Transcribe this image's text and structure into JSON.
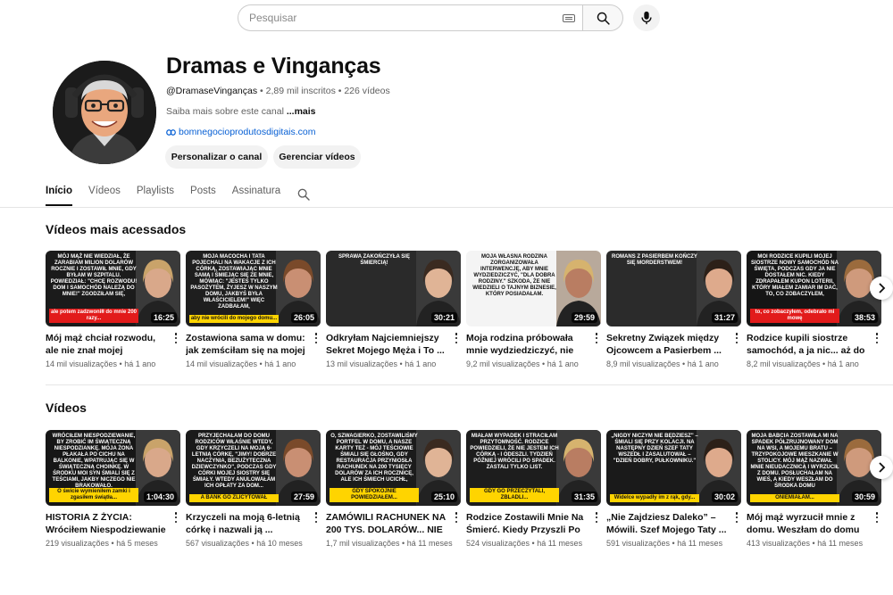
{
  "search": {
    "placeholder": "Pesquisar"
  },
  "channel": {
    "name": "Dramas e Vinganças",
    "handle": "@DramaseVinganças",
    "subscribers": "2,89 mil inscritos",
    "videos_count": "226 vídeos",
    "about": "Saiba mais sobre este canal",
    "about_more": "...mais",
    "link": "bomnegocioprodutosdigitais.com",
    "customize_label": "Personalizar o canal",
    "manage_label": "Gerenciar vídeos"
  },
  "tabs": [
    "Início",
    "Vídeos",
    "Playlists",
    "Posts",
    "Assinatura"
  ],
  "sections": {
    "popular": {
      "title": "Vídeos mais acessados",
      "videos": [
        {
          "title": "Mój mąż chciał rozwodu, ale nie znał mojej tajemnicy...",
          "views": "14 mil visualizações",
          "age": "há 1 ano",
          "duration": "16:25",
          "thumb_text": "Mój mąż nie wiedział, że zarabiam milion dolarów rocznie i zostawił mnie, gdy byłam w szpitalu. Powiedział: \"Chcę rozwodu! Dom i samochód należą do mnie!\" Zgodziłam się,",
          "thumb_bar": "ale potem zadzwoniłł do mnie 200 razy...",
          "bg": "#1b1b1b",
          "bar": "#e21b1b"
        },
        {
          "title": "Zostawiona sama w domu: jak zemściłam się na mojej ...",
          "views": "14 mil visualizações",
          "age": "há 1 ano",
          "duration": "26:05",
          "thumb_text": "Moja macocha i tata pojechali na wakacje z ich córką, zostawiając mnie samą i śmiejąc się ze mnie, mówiąc: \"Jesteś tylko pasożytem, żyjesz w naszym domu, jakbyś była właścicielem!\" Więc zadbałam,",
          "thumb_bar": "aby nie wrócili do mojego domu...",
          "bg": "#1e1e1e",
          "bar": "#ffd400"
        },
        {
          "title": "Odkryłam Najciemniejszy Sekret Mojego Męża i To ...",
          "views": "13 mil visualizações",
          "age": "há 1 ano",
          "duration": "30:21",
          "thumb_text": "Sprawa zakończyła się śmiercią!",
          "thumb_bar": "",
          "bg": "#2a2a2a",
          "bar": "#ffd400"
        },
        {
          "title": "Moja rodzina próbowała mnie wydziedziczyć, nie wiedząc ...",
          "views": "9,2 mil visualizações",
          "age": "há 1 ano",
          "duration": "29:59",
          "thumb_text": "Moja własna rodzina zorganizowała interwencję, aby mnie wydziedziczyć, \"dla dobra rodziny.\" Szkoda, że nie wiedzieli o tajnym biznesie, który posiadałam.",
          "thumb_bar": "",
          "bg": "#f4f4f4",
          "bar": "#ffd400"
        },
        {
          "title": "Sekretny Związek między Ojcowcem a Pasierbem ...",
          "views": "8,9 mil visualizações",
          "age": "há 1 ano",
          "duration": "31:27",
          "thumb_text": "Romans z pasierbem kończy się morderstwem!",
          "thumb_bar": "",
          "bg": "#2b2b2b",
          "bar": "#ffd400"
        },
        {
          "title": "Rodzice kupili siostrze samochód, a ja nic... aż do ...",
          "views": "8,2 mil visualizações",
          "age": "há 1 ano",
          "duration": "38:53",
          "thumb_text": "Moi rodzice kupili mojej siostrze nowy samochód na święta, podczas gdy ja nie dostałem nic. Kiedy zdrapałem kupon loterii, który miałem zamiar im dać, to, co zobaczyłem,",
          "thumb_bar": "to, co zobaczyłem, odebrało mi mowę",
          "bg": "#151515",
          "bar": "#e21b1b"
        }
      ]
    },
    "videos": {
      "title": "Vídeos",
      "videos": [
        {
          "title": "HISTORIA Z ŻYCIA: Wróciłem Niespodziewanie Na Święta...",
          "views": "219 visualizações",
          "age": "há 5 meses",
          "duration": "1:04:30",
          "thumb_text": "Wróciłem niespodziewanie, by zrobić im świąteczną niespodziankę. Moja żona płakała po cichu na balkonie, wpatrując się w świąteczną choinkę. W środku moi syn śmiali się z teściami, jakby niczego nie brakowało.",
          "thumb_bar": "O świcie wymieniłem zamki i zgasiłem świątła...",
          "bg": "#161616",
          "bar": "#ffd400"
        },
        {
          "title": "Krzyczeli na moją 6-letnią córkę i nazwali ją ...",
          "views": "567 visualizações",
          "age": "há 10 meses",
          "duration": "27:59",
          "thumb_text": "Przyjechałam do domu rodziców właśnie wtedy, gdy krzyczeli na moją 6-letnią córkę, \"Jimy! Dobrze naczynia, bezużyteczna dziewczynko\", podczas gdy córki mojej siostry się śmiały. Wtedy anulowałam ich opłaty za dom...",
          "thumb_bar": "A BANK GO ZLICYTOWAŁ",
          "bg": "#1a1a1a",
          "bar": "#ffd400"
        },
        {
          "title": "ZAMÓWILI RACHUNEK NA 200 TYS. DOLARÓW... NIE ...",
          "views": "1,7 mil visualizações",
          "age": "há 11 meses",
          "duration": "25:10",
          "thumb_text": "O, szwagierko, zostawiliśmy portfel w domu, a nasze karty też - mój teściowie śmiali się głośno, gdy restauracja przyniosła rachunek na 200 tysięcy dolarów za ich rocznicę, ale ich śmiech ucichł,",
          "thumb_bar": "GDY SPOKOJNIE POWIEDZIAŁEM...",
          "bg": "#1b1b1b",
          "bar": "#ffd400"
        },
        {
          "title": "Rodzice Zostawili Mnie Na Śmierć. Kiedy Przyszli Po ...",
          "views": "524 visualizações",
          "age": "há 11 meses",
          "duration": "31:35",
          "thumb_text": "Miałam wypadek i straciłam przytomność. Rodzice powiedzieli, że nie jestem ich córką - i odeszli. Tydzień później wrócili po spadek. Zastali tylko list.",
          "thumb_bar": "GDY GO PRZECZYTALI, ZBLADLI...",
          "bg": "#1d1d1d",
          "bar": "#ffd400"
        },
        {
          "title": "„Nie Zajdziesz Daleko” – Mówili. Szef Mojego Taty ...",
          "views": "591 visualizações",
          "age": "há 11 meses",
          "duration": "30:02",
          "thumb_text": "„Nigdy niczym nie będziesz\" – śmiali się przy kolacji. Na następny dzień szef taty wszedł i zasalutował – \"Dzień dobry, Pułkowniku.\"",
          "thumb_bar": "Widelce wypadły im z rąk, gdy...",
          "bg": "#1a1a1a",
          "bar": "#ffd400"
        },
        {
          "title": "Mój mąż wyrzucił mnie z domu. Weszłam do domu ...",
          "views": "413 visualizações",
          "age": "há 11 meses",
          "duration": "30:59",
          "thumb_text": "Moja babcia zostawiła mi na spadek półzrujnowany dom na wsi, a mojemu bratu – trzypokojowe mieszkanie w stolicy. Mój mąż nazwał mnie nieudacznicą i wyrzucił z domu. Posłuchałam na wieś, a kiedy weszłam do środka domu",
          "thumb_bar": "ONIEMIAŁAM...",
          "bg": "#1c1c1c",
          "bar": "#ffd400"
        }
      ]
    }
  }
}
